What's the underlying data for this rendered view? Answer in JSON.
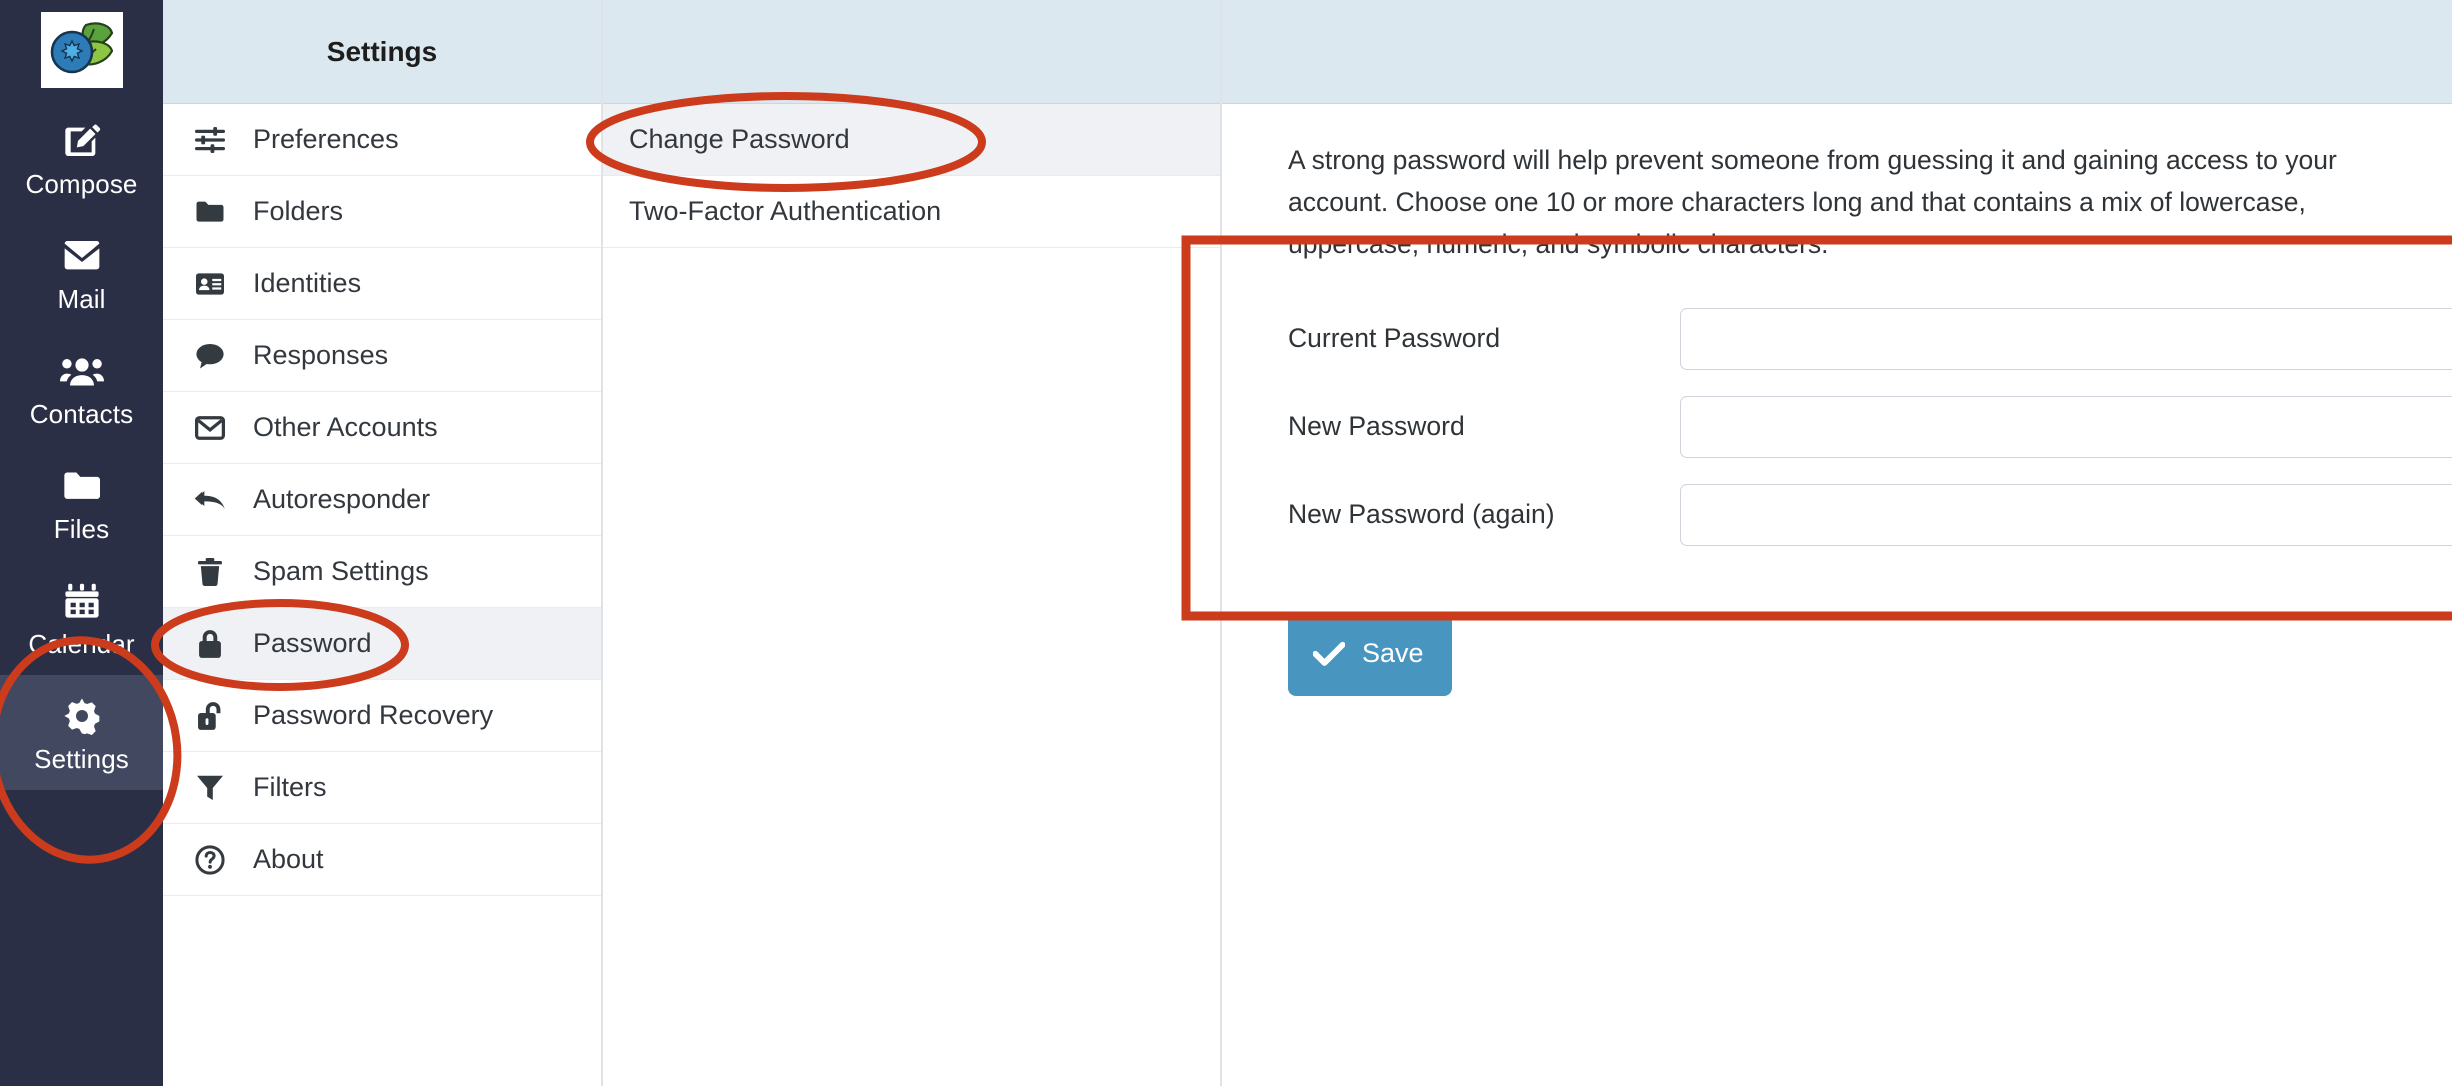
{
  "app": {
    "logo_icon": "blueberry-logo-icon"
  },
  "rail": {
    "items": [
      {
        "label": "Compose",
        "icon": "compose-icon",
        "active": false
      },
      {
        "label": "Mail",
        "icon": "mail-icon",
        "active": false
      },
      {
        "label": "Contacts",
        "icon": "contacts-icon",
        "active": false
      },
      {
        "label": "Files",
        "icon": "files-icon",
        "active": false
      },
      {
        "label": "Calendar",
        "icon": "calendar-icon",
        "active": false
      },
      {
        "label": "Settings",
        "icon": "gear-icon",
        "active": true
      }
    ]
  },
  "settings_panel": {
    "title": "Settings",
    "items": [
      {
        "label": "Preferences",
        "icon": "sliders-icon",
        "selected": false
      },
      {
        "label": "Folders",
        "icon": "folder-icon",
        "selected": false
      },
      {
        "label": "Identities",
        "icon": "id-card-icon",
        "selected": false
      },
      {
        "label": "Responses",
        "icon": "chat-bubble-icon",
        "selected": false
      },
      {
        "label": "Other Accounts",
        "icon": "envelope-icon",
        "selected": false
      },
      {
        "label": "Autoresponder",
        "icon": "reply-all-icon",
        "selected": false
      },
      {
        "label": "Spam Settings",
        "icon": "trash-icon",
        "selected": false
      },
      {
        "label": "Password",
        "icon": "lock-closed-icon",
        "selected": true
      },
      {
        "label": "Password Recovery",
        "icon": "lock-open-icon",
        "selected": false
      },
      {
        "label": "Filters",
        "icon": "funnel-icon",
        "selected": false
      },
      {
        "label": "About",
        "icon": "question-mark-icon",
        "selected": false
      }
    ]
  },
  "section_panel": {
    "items": [
      {
        "label": "Change Password",
        "selected": true
      },
      {
        "label": "Two-Factor Authentication",
        "selected": false
      }
    ]
  },
  "content": {
    "intro": "A strong password will help prevent someone from guessing it and gaining access to your account. Choose one 10 or more characters long and that contains a mix of lowercase, uppercase, numeric, and symbolic characters.",
    "fields": [
      {
        "label": "Current Password",
        "value": "",
        "placeholder": ""
      },
      {
        "label": "New Password",
        "value": "",
        "placeholder": ""
      },
      {
        "label": "New Password (again)",
        "value": "",
        "placeholder": ""
      }
    ],
    "save_label": "Save",
    "save_icon": "check-icon"
  },
  "annotations": {
    "color": "#cc3b1c",
    "shapes": [
      {
        "type": "ellipse",
        "target": "sidebar-item-settings"
      },
      {
        "type": "ellipse",
        "target": "settings-item-password"
      },
      {
        "type": "ellipse",
        "target": "section-item-change-password"
      },
      {
        "type": "rect",
        "target": "change-password-form"
      }
    ]
  },
  "colors": {
    "rail_bg": "#2b2f45",
    "rail_active_bg": "#434861",
    "panel_header_bg": "#dce8ef",
    "selected_row_bg": "#f0f1f5",
    "save_button_bg": "#4896c0",
    "annotation_red": "#cc3b1c"
  }
}
